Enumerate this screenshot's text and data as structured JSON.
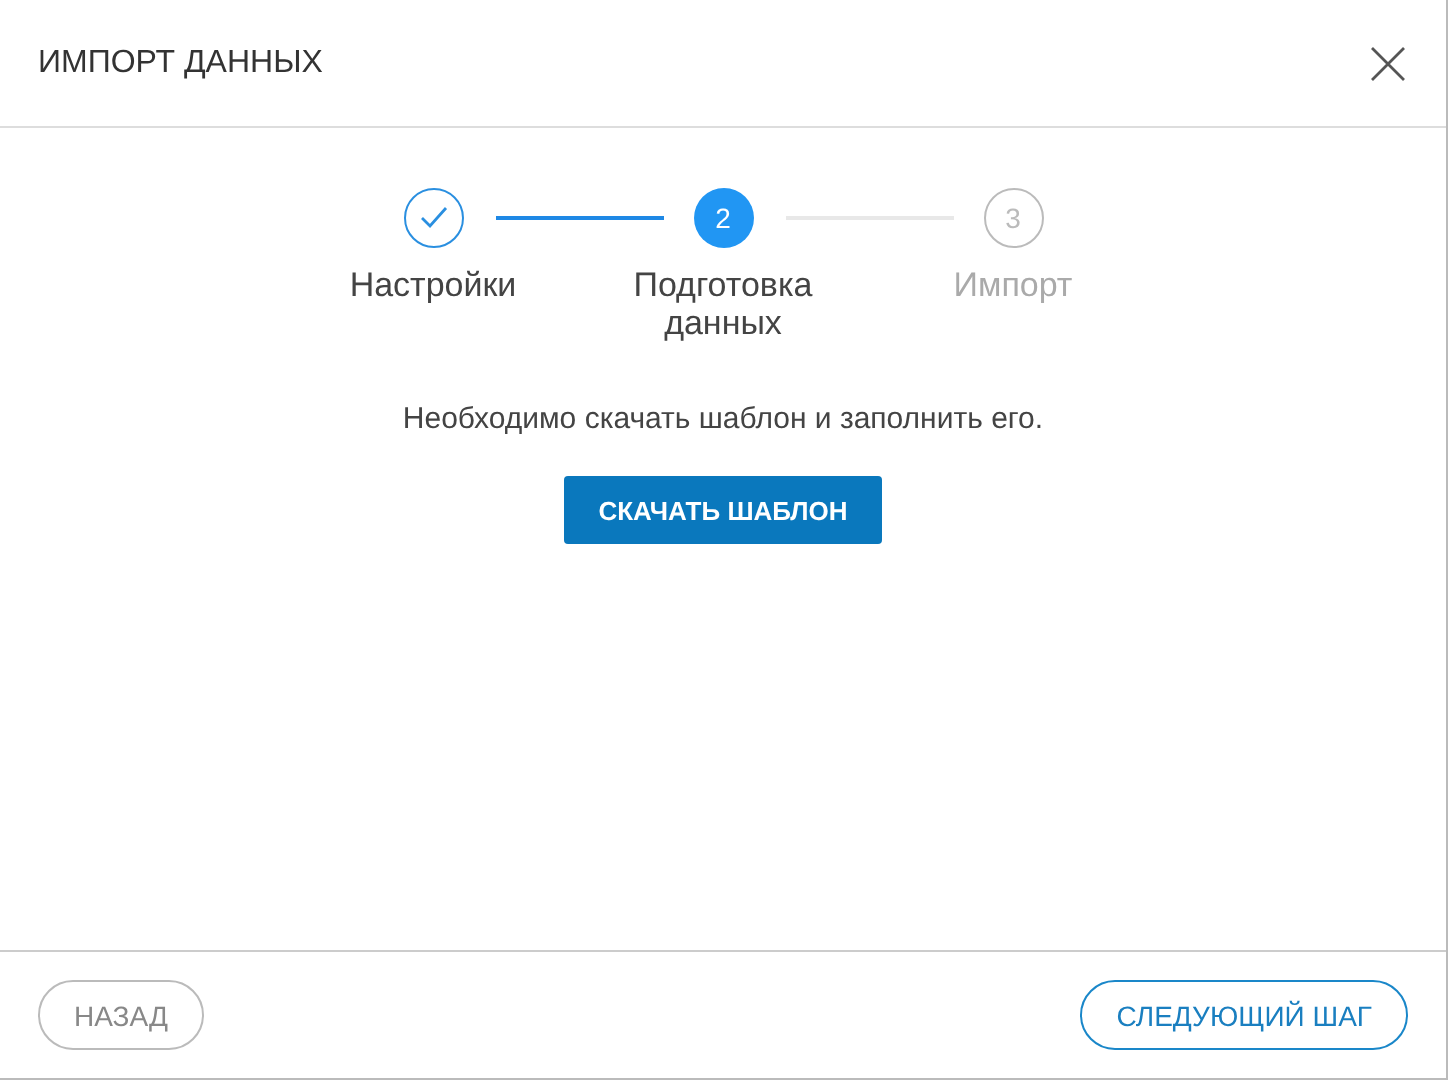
{
  "window": {
    "title": "ИМПОРТ ДАННЫХ"
  },
  "steps": [
    {
      "label": "Настройки",
      "kind": "done"
    },
    {
      "number": "2",
      "label": "Подготовка данных",
      "kind": "current"
    },
    {
      "number": "3",
      "label": "Импорт",
      "kind": "pending"
    }
  ],
  "message": "Необходимо скачать шаблон и заполнить его.",
  "download_button": "СКАЧАТЬ ШАБЛОН",
  "footer": {
    "back_button": "НАЗАД",
    "next_button": "СЛЕДУЮЩИЙ ШАГ"
  }
}
